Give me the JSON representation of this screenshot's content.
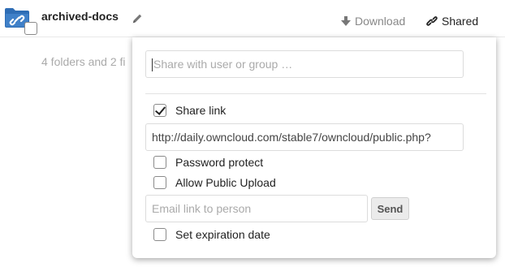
{
  "file": {
    "name": "archived-docs",
    "summary": "4 folders and 2 fi"
  },
  "actions": {
    "download_label": "Download",
    "shared_label": "Shared"
  },
  "share": {
    "input_placeholder": "Share with user or group …",
    "share_link_label": "Share link",
    "share_link_checked": true,
    "link_url": "http://daily.owncloud.com/stable7/owncloud/public.php?",
    "password_label": "Password protect",
    "password_checked": false,
    "upload_label": "Allow Public Upload",
    "upload_checked": false,
    "email_placeholder": "Email link to person",
    "send_label": "Send",
    "expiration_label": "Set expiration date",
    "expiration_checked": false
  },
  "icons": {
    "folder": "shared-folder-icon",
    "rename": "pencil-icon",
    "download": "download-arrow-icon",
    "shared": "link-icon"
  },
  "colors": {
    "folder_blue": "#2e6db5",
    "muted_text": "#888888"
  }
}
